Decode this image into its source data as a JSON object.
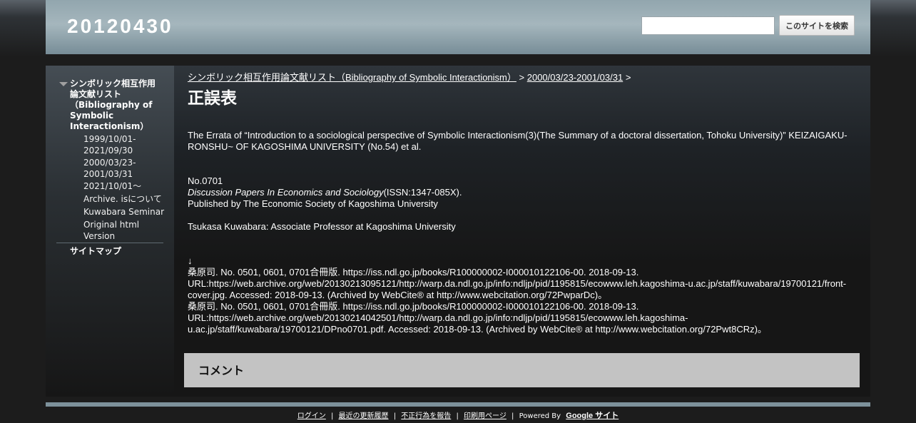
{
  "header": {
    "site_title": "20120430",
    "search_value": "",
    "search_button": "このサイトを検索"
  },
  "sidebar": {
    "main_item": "シンボリック相互作用論文献リスト（Bibliography of Symbolic Interactionism）",
    "sub_items": [
      {
        "label": "1999/10/01-2021/09/30"
      },
      {
        "label": "2000/03/23-2001/03/31"
      },
      {
        "label": "2021/10/01～"
      },
      {
        "label": "Archive. isについて"
      },
      {
        "label": "Kuwabara Seminar"
      },
      {
        "label": "Original html Version"
      }
    ],
    "sitemap": "サイトマップ"
  },
  "breadcrumb": {
    "link1": "シンボリック相互作用論文献リスト（Bibliography of Symbolic Interactionism）",
    "sep": ">",
    "link2": "2000/03/23-2001/03/31"
  },
  "page": {
    "title": "正誤表",
    "errata": "The Errata of “Introduction to a sociological perspective of Symbolic Interactionism(3)(The Summary of a doctoral dissertation, Tohoku University)” KEIZAIGAKU-RONSHU~ OF KAGOSHIMA UNIVERSITY (No.54) et al.",
    "number": "No.0701",
    "series_italic": "Discussion Papers In Economics and Sociology",
    "issn": "(ISSN:1347-085X).",
    "publisher": "Published by The Economic Society of Kagoshima University",
    "author": "Tsukasa Kuwabara: Associate Professor at Kagoshima University",
    "arrow": "↓",
    "ref1": "桑原司. No. 0501, 0601, 0701合冊版. https://iss.ndl.go.jp/books/R100000002-I000010122106-00. 2018-09-13. URL:https://web.archive.org/web/20130213095121/http://warp.da.ndl.go.jp/info:ndljp/pid/1195815/ecowww.leh.kagoshima-u.ac.jp/staff/kuwabara/19700121/front-cover.jpg. Accessed: 2018-09-13. (Archived by WebCite® at http://www.webcitation.org/72PwparDc)。",
    "ref2": "桑原司. No. 0501, 0601, 0701合冊版. https://iss.ndl.go.jp/books/R100000002-I000010122106-00. 2018-09-13. URL:https://web.archive.org/web/20130214042501/http://warp.da.ndl.go.jp/info:ndljp/pid/1195815/ecowww.leh.kagoshima-u.ac.jp/staff/kuwabara/19700121/DPno0701.pdf. Accessed: 2018-09-13. (Archived by WebCite® at http://www.webcitation.org/72Pwt8CRz)。",
    "comment_title": "コメント"
  },
  "footer": {
    "login": "ログイン",
    "recent": "最近の更新履歴",
    "report": "不正行為を報告",
    "print": "印刷用ページ",
    "powered_by": "Powered By",
    "google_sites": "Google サイト",
    "divider": "|"
  }
}
